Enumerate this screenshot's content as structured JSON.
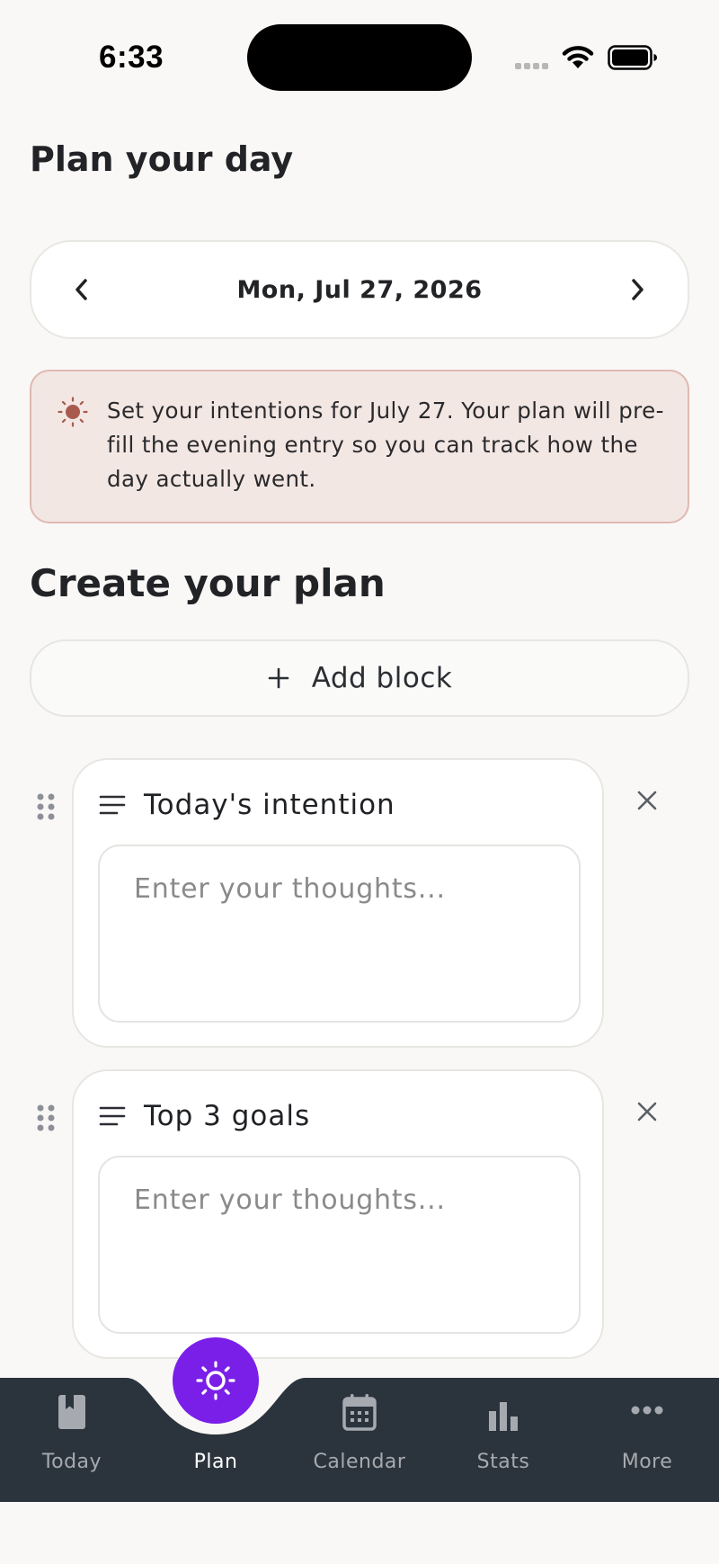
{
  "status_bar": {
    "time": "6:33"
  },
  "page": {
    "title": "Plan your day"
  },
  "date_selector": {
    "date": "Mon, Jul 27, 2026"
  },
  "info_banner": {
    "icon": "sun-icon",
    "text": "Set your intentions for July 27. Your plan will pre-fill the evening entry so you can track how the day actually went."
  },
  "plan": {
    "section_title": "Create your plan",
    "add_block_label": "Add block",
    "blocks": [
      {
        "title": "Today's intention",
        "placeholder": "Enter your thoughts...",
        "value": ""
      },
      {
        "title": "Top 3 goals",
        "placeholder": "Enter your thoughts...",
        "value": ""
      }
    ]
  },
  "tab_bar": {
    "tabs": [
      {
        "label": "Today",
        "icon": "book-icon",
        "active": false
      },
      {
        "label": "Plan",
        "icon": "sun-icon",
        "active": true
      },
      {
        "label": "Calendar",
        "icon": "calendar-icon",
        "active": false
      },
      {
        "label": "Stats",
        "icon": "bar-chart-icon",
        "active": false
      },
      {
        "label": "More",
        "icon": "more-dots-icon",
        "active": false
      }
    ]
  },
  "colors": {
    "accent": "#7a1fe8",
    "tab_bar_bg": "#2b343c",
    "banner_bg": "#f3e7e4",
    "banner_border": "#dfb9b2",
    "banner_icon": "#a85b4d",
    "page_bg": "#f9f8f6"
  }
}
